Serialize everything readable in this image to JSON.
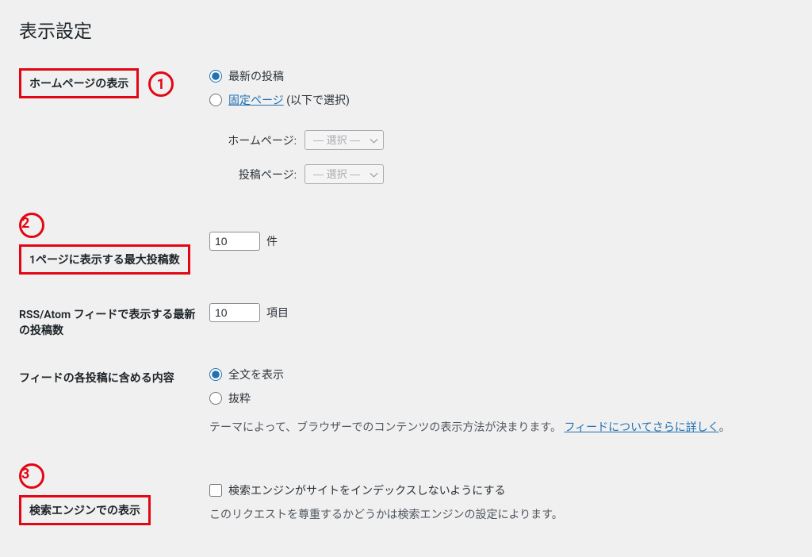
{
  "page": {
    "title": "表示設定"
  },
  "annotations": {
    "one": "1",
    "two": "2",
    "three": "3"
  },
  "homepage": {
    "label": "ホームページの表示",
    "option_latest": "最新の投稿",
    "option_static_link": "固定ページ",
    "option_static_suffix": "(以下で選択)",
    "sub_homepage_label": "ホームページ:",
    "sub_posts_label": "投稿ページ:",
    "select_placeholder": "— 選択 —"
  },
  "posts_per_page": {
    "label": "1ページに表示する最大投稿数",
    "value": "10",
    "unit": "件"
  },
  "rss_items": {
    "label": "RSS/Atom フィードで表示する最新の投稿数",
    "value": "10",
    "unit": "項目"
  },
  "feed_content": {
    "label": "フィードの各投稿に含める内容",
    "option_full": "全文を表示",
    "option_excerpt": "抜粋",
    "description_prefix": "テーマによって、ブラウザーでのコンテンツの表示方法が決まります。",
    "description_link": "フィードについてさらに詳しく",
    "description_suffix": "。"
  },
  "search_engine": {
    "label": "検索エンジンでの表示",
    "checkbox_label": "検索エンジンがサイトをインデックスしないようにする",
    "description": "このリクエストを尊重するかどうかは検索エンジンの設定によります。"
  }
}
